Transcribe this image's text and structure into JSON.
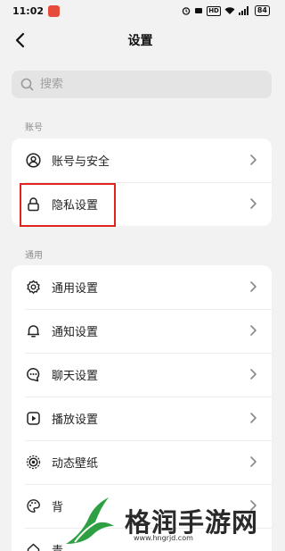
{
  "status_bar": {
    "time": "11:02",
    "battery": "84",
    "network": "HD"
  },
  "header": {
    "title": "设置"
  },
  "search": {
    "placeholder": "搜索"
  },
  "sections": {
    "account": {
      "label": "账号",
      "items": [
        {
          "label": "账号与安全",
          "icon": "account-icon"
        },
        {
          "label": "隐私设置",
          "icon": "lock-icon"
        }
      ]
    },
    "general": {
      "label": "通用",
      "items": [
        {
          "label": "通用设置",
          "icon": "gear-icon"
        },
        {
          "label": "通知设置",
          "icon": "bell-icon"
        },
        {
          "label": "聊天设置",
          "icon": "chat-icon"
        },
        {
          "label": "播放设置",
          "icon": "play-icon"
        },
        {
          "label": "动态壁纸",
          "icon": "wallpaper-icon"
        },
        {
          "label": "背",
          "icon": "palette-icon"
        },
        {
          "label": "青",
          "icon": "home-icon"
        }
      ]
    }
  },
  "watermark": {
    "text": "格润手游网",
    "url": "www.hngrjd.com"
  },
  "colors": {
    "highlight": "#e0231c",
    "background": "#f2f2f2"
  }
}
